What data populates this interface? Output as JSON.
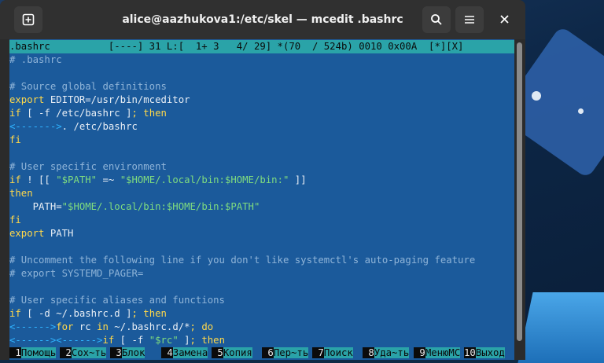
{
  "window": {
    "title": "alice@aazhukova1:/etc/skel — mcedit .bashrc"
  },
  "status_bar": {
    "text": ".bashrc          [----] 31 L:[  1+ 3   4/ 29] *(70  / 524b) 0010 0x00A  [*][X]"
  },
  "editor_lines": [
    [
      {
        "t": "# .bashrc",
        "c": "cm"
      }
    ],
    [
      {
        "t": "",
        "c": "pl"
      }
    ],
    [
      {
        "t": "# Source global definitions",
        "c": "cm"
      }
    ],
    [
      {
        "t": "export",
        "c": "kw"
      },
      {
        "t": " EDITOR=/usr/bin/mceditor",
        "c": "pl"
      }
    ],
    [
      {
        "t": "if",
        "c": "kw"
      },
      {
        "t": " [ -f /etc/bashrc ]",
        "c": "pl"
      },
      {
        "t": "; then",
        "c": "kw"
      }
    ],
    [
      {
        "t": "<------->",
        "c": "tab"
      },
      {
        "t": ". /etc/bashrc",
        "c": "pl"
      }
    ],
    [
      {
        "t": "fi",
        "c": "kw"
      }
    ],
    [
      {
        "t": "",
        "c": "pl"
      }
    ],
    [
      {
        "t": "# User specific environment",
        "c": "cm"
      }
    ],
    [
      {
        "t": "if",
        "c": "kw"
      },
      {
        "t": " ! [[ ",
        "c": "pl"
      },
      {
        "t": "\"$PATH\"",
        "c": "str"
      },
      {
        "t": " =~ ",
        "c": "pl"
      },
      {
        "t": "\"$HOME/.local/bin:$HOME/bin:\"",
        "c": "str"
      },
      {
        "t": " ]]",
        "c": "pl"
      }
    ],
    [
      {
        "t": "then",
        "c": "kw"
      }
    ],
    [
      {
        "t": "    PATH=",
        "c": "pl"
      },
      {
        "t": "\"$HOME/.local/bin:$HOME/bin:$PATH\"",
        "c": "str"
      }
    ],
    [
      {
        "t": "fi",
        "c": "kw"
      }
    ],
    [
      {
        "t": "export",
        "c": "kw"
      },
      {
        "t": " PATH",
        "c": "pl"
      }
    ],
    [
      {
        "t": "",
        "c": "pl"
      }
    ],
    [
      {
        "t": "# Uncomment the following line if you don't like systemctl's auto-paging feature",
        "c": "cm"
      }
    ],
    [
      {
        "t": "# export SYSTEMD_PAGER=",
        "c": "cm"
      }
    ],
    [
      {
        "t": "",
        "c": "pl"
      }
    ],
    [
      {
        "t": "# User specific aliases and functions",
        "c": "cm"
      }
    ],
    [
      {
        "t": "if",
        "c": "kw"
      },
      {
        "t": " [ -d ~/.bashrc.d ]",
        "c": "pl"
      },
      {
        "t": "; then",
        "c": "kw"
      }
    ],
    [
      {
        "t": "<------>",
        "c": "tab"
      },
      {
        "t": "for",
        "c": "kw"
      },
      {
        "t": " rc ",
        "c": "pl"
      },
      {
        "t": "in",
        "c": "kw"
      },
      {
        "t": " ~/.bashrc.d/*",
        "c": "pl"
      },
      {
        "t": "; do",
        "c": "kw"
      }
    ],
    [
      {
        "t": "<------><------>",
        "c": "tab"
      },
      {
        "t": "if",
        "c": "kw"
      },
      {
        "t": " [ -f ",
        "c": "pl"
      },
      {
        "t": "\"$rc\"",
        "c": "str"
      },
      {
        "t": " ]",
        "c": "pl"
      },
      {
        "t": "; then",
        "c": "kw"
      }
    ]
  ],
  "function_keys": [
    {
      "n": "1",
      "label": "Помощь"
    },
    {
      "n": "2",
      "label": "Сох~ть"
    },
    {
      "n": "3",
      "label": "Блок"
    },
    {
      "n": "4",
      "label": "Замена"
    },
    {
      "n": "5",
      "label": "Копия"
    },
    {
      "n": "6",
      "label": "Пер~ть"
    },
    {
      "n": "7",
      "label": "Поиск"
    },
    {
      "n": "8",
      "label": "Уда~ть"
    },
    {
      "n": "9",
      "label": "МенюMC"
    },
    {
      "n": "10",
      "label": "Выход"
    }
  ],
  "colors": {
    "editor_bg": "#1b5a9b",
    "status_bg": "#2aa3a8",
    "keyword": "#ffd84a",
    "string": "#7fdc7f",
    "comment": "#8fb4d8"
  },
  "icons": {
    "new_tab": "new-tab-icon",
    "search": "search-icon",
    "menu": "hamburger-menu-icon",
    "close": "close-icon"
  }
}
